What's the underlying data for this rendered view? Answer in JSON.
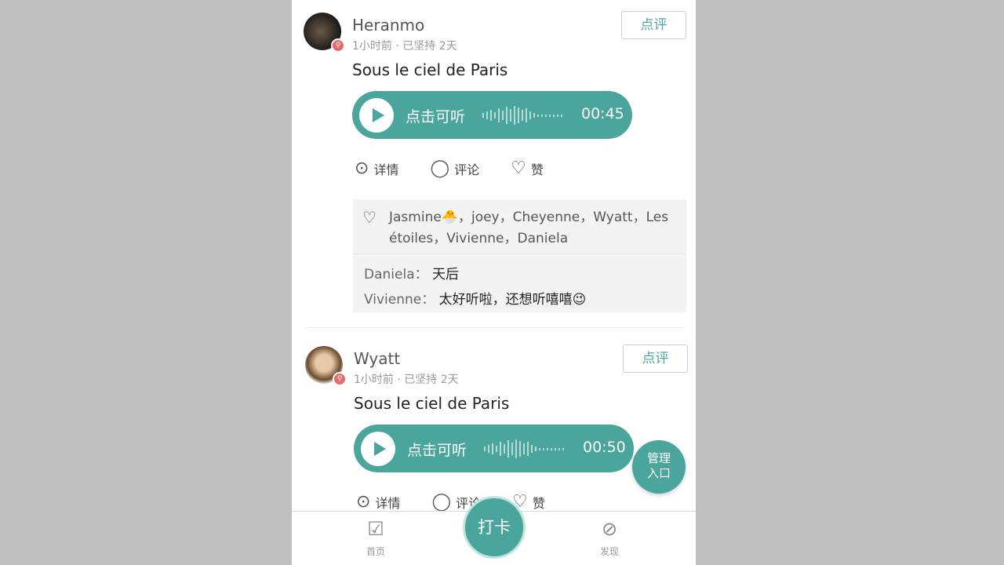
{
  "posts": [
    {
      "user": "Heranmo",
      "meta": "1小时前 · 已坚持 2天",
      "review": "点评",
      "title": "Sous le ciel de Paris",
      "audio_label": "点击可听",
      "duration": "00:45",
      "actions": {
        "details": "详情",
        "comment": "评论",
        "like": "赞"
      },
      "likers": "Jasmine🐣，joey，Cheyenne，Wyatt，Les étoiles，Vivienne，Daniela",
      "comments": [
        {
          "author": "Daniela：",
          "text": "天后"
        },
        {
          "author": "Vivienne：",
          "text": "太好听啦，还想听嘻嘻😉"
        }
      ]
    },
    {
      "user": "Wyatt",
      "meta": "1小时前 · 已坚持 2天",
      "review": "点评",
      "title": "Sous le ciel de Paris",
      "audio_label": "点击可听",
      "duration": "00:50",
      "actions": {
        "details": "详情",
        "comment": "评论",
        "like": "赞"
      }
    }
  ],
  "fab": {
    "line1": "管理",
    "line2": "入口"
  },
  "tabbar": {
    "home": "首页",
    "checkin": "打卡",
    "discover": "发现"
  },
  "colors": {
    "accent": "#4aa69d",
    "background": "#bfbfbf"
  }
}
